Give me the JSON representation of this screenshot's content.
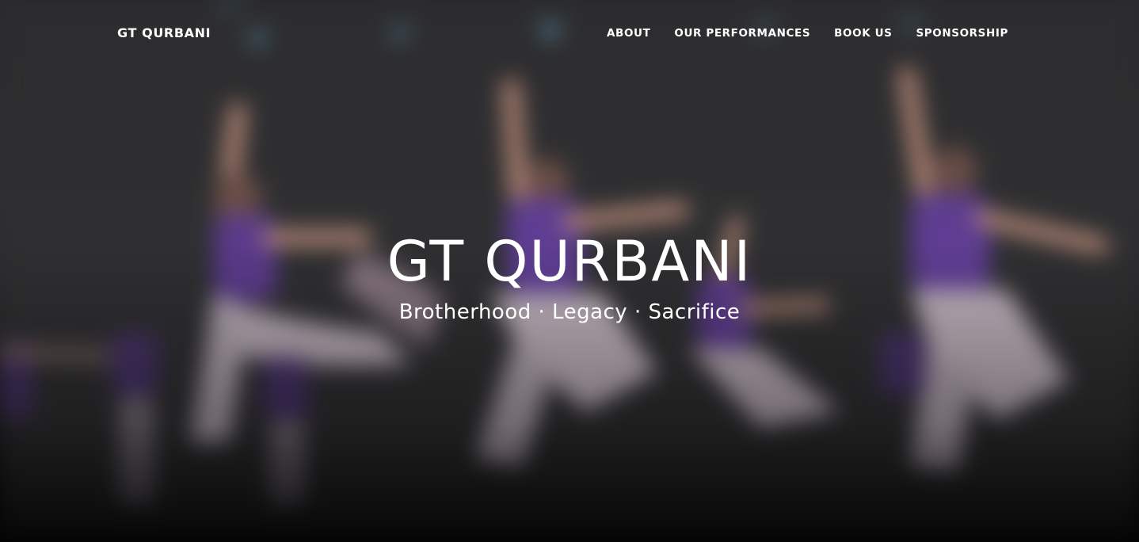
{
  "navbar": {
    "brand": "GT QURBANI",
    "links": [
      {
        "label": "ABOUT"
      },
      {
        "label": "OUR PERFORMANCES"
      },
      {
        "label": "BOOK US"
      },
      {
        "label": "SPONSORSHIP"
      }
    ]
  },
  "hero": {
    "title": "GT QURBANI",
    "tagline": "Brotherhood · Legacy · Sacrifice",
    "image": "blurred-dancers-background"
  },
  "colors": {
    "text": "#ffffff",
    "costume_purple": "#6a3aa0",
    "background": "#2e2e30"
  }
}
